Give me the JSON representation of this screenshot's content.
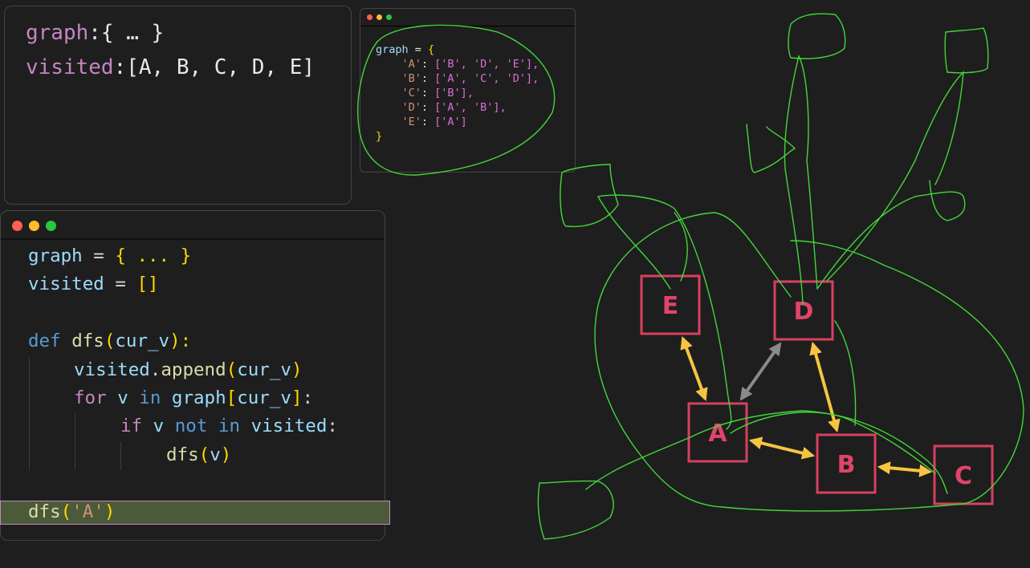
{
  "state_panel": {
    "graph_key": "graph",
    "graph_value": ":{ … }",
    "visited_key": "visited",
    "visited_value": ":[A, B, C, D, E]"
  },
  "mini_code": {
    "line0_var": "graph",
    "line0_rest": " = ",
    "line0_brace": "{",
    "entries": [
      {
        "key": "'A'",
        "values": "['B', 'D', 'E'],"
      },
      {
        "key": "'B'",
        "values": "['A', 'C', 'D'],"
      },
      {
        "key": "'C'",
        "values": "['B'],"
      },
      {
        "key": "'D'",
        "values": "['A', 'B'],"
      },
      {
        "key": "'E'",
        "values": "['A']"
      }
    ],
    "close_brace": "}"
  },
  "code": {
    "l1_graph": "graph",
    "l1_eq": " = ",
    "l1_val": "{ ... }",
    "l2_visited": "visited",
    "l2_eq": " = ",
    "l2_val": "[]",
    "l4_def": "def",
    "l4_fn": "dfs",
    "l4_open": "(",
    "l4_arg": "cur_v",
    "l4_close": "):",
    "l5_obj": "visited",
    "l5_dot": ".",
    "l5_method": "append",
    "l5_open": "(",
    "l5_arg": "cur_v",
    "l5_close": ")",
    "l6_for": "for",
    "l6_v": "v",
    "l6_in": "in",
    "l6_graph": "graph",
    "l6_ob": "[",
    "l6_arg": "cur_v",
    "l6_cb": "]",
    "l6_colon": ":",
    "l7_if": "if",
    "l7_v": "v",
    "l7_not": "not",
    "l7_in": "in",
    "l7_visited": "visited",
    "l7_colon": ":",
    "l8_fn": "dfs",
    "l8_open": "(",
    "l8_arg": "v",
    "l8_close": ")",
    "l10_fn": "dfs",
    "l10_open": "(",
    "l10_arg": "'A'",
    "l10_close": ")"
  },
  "nodes": [
    {
      "id": "E",
      "label": "E"
    },
    {
      "id": "D",
      "label": "D"
    },
    {
      "id": "A",
      "label": "A"
    },
    {
      "id": "B",
      "label": "B"
    },
    {
      "id": "C",
      "label": "C"
    }
  ],
  "edges": [
    {
      "from": "E",
      "to": "A",
      "state": "visited"
    },
    {
      "from": "D",
      "to": "A",
      "state": "pending"
    },
    {
      "from": "D",
      "to": "B",
      "state": "visited"
    },
    {
      "from": "A",
      "to": "B",
      "state": "visited"
    },
    {
      "from": "B",
      "to": "C",
      "state": "visited"
    }
  ],
  "colors": {
    "node_stroke": "#d8405f",
    "node_label": "#e0446a",
    "visited_edge": "#f5c542",
    "pending_edge": "#8a8a8a",
    "annotation": "#43d63a",
    "highlight": "#4b5a38"
  }
}
